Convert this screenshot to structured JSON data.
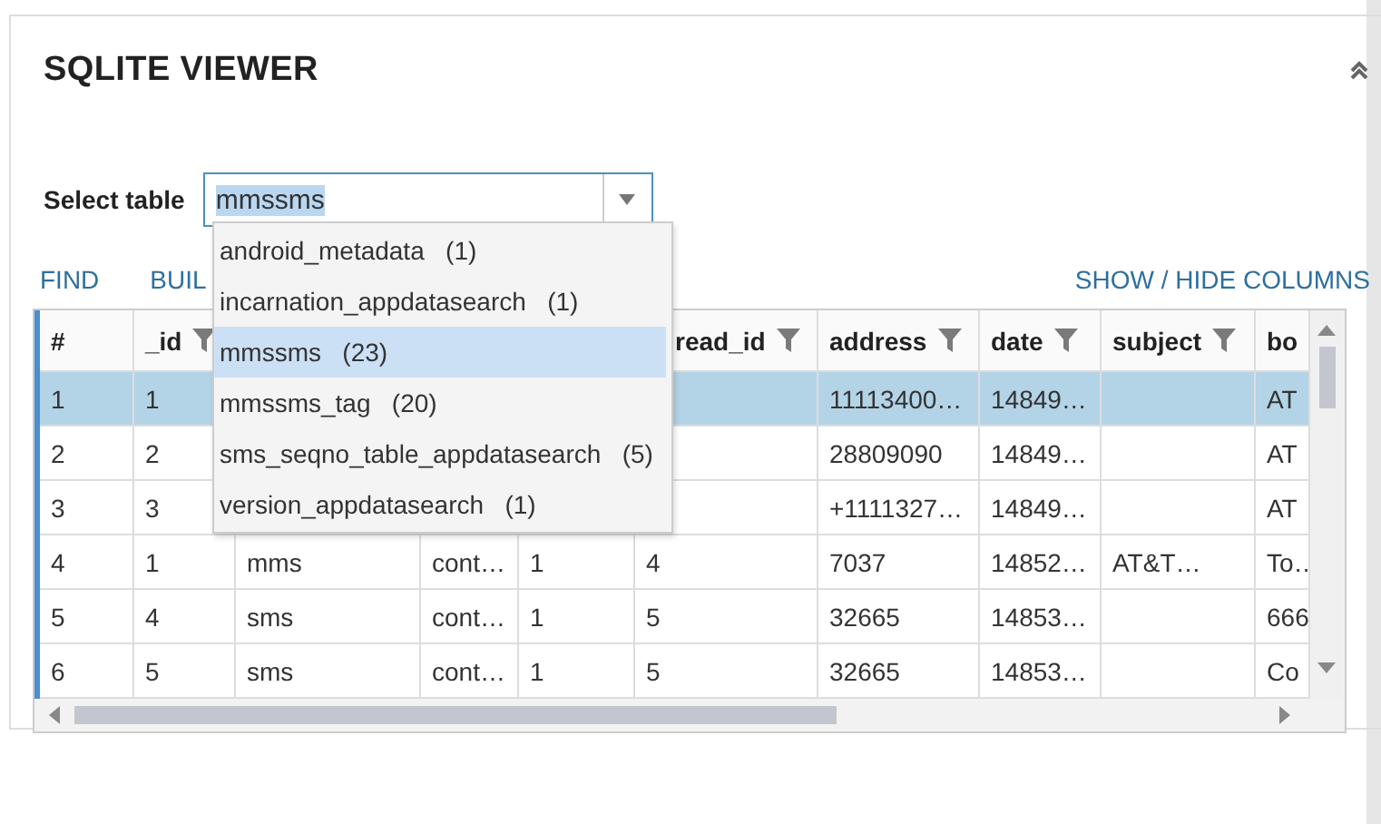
{
  "panel": {
    "title": "SQLITE VIEWER",
    "collapsed": false
  },
  "select_table": {
    "label": "Select table",
    "value": "mmssms",
    "text_selected": true,
    "expanded": true,
    "options": [
      {
        "name": "android_metadata",
        "count": "(1)",
        "selected": false
      },
      {
        "name": "incarnation_appdatasearch",
        "count": "(1)",
        "selected": false
      },
      {
        "name": "mmssms",
        "count": "(23)",
        "selected": true
      },
      {
        "name": "mmssms_tag",
        "count": "(20)",
        "selected": false
      },
      {
        "name": "sms_seqno_table_appdatasearch",
        "count": "(5)",
        "selected": false
      },
      {
        "name": "version_appdatasearch",
        "count": "(1)",
        "selected": false
      }
    ]
  },
  "toolbar": {
    "links": [
      "FIND",
      "BUIL"
    ],
    "show_hide": "SHOW / HIDE COLUMNS"
  },
  "table": {
    "columns": [
      {
        "label": "#",
        "filter": false
      },
      {
        "label": "_id",
        "filter": true
      },
      {},
      {},
      {},
      {
        "label": "read_id",
        "filter": true
      },
      {
        "label": "address",
        "filter": true
      },
      {
        "label": "date",
        "filter": true
      },
      {
        "label": "subject",
        "filter": true
      },
      {
        "label": "bo",
        "filter": false
      }
    ],
    "rows": [
      {
        "selected": true,
        "cells": [
          "1",
          "1",
          null,
          null,
          null,
          null,
          "11113400…",
          "14849…",
          null,
          "AT"
        ]
      },
      {
        "selected": false,
        "cells": [
          "2",
          "2",
          null,
          null,
          null,
          null,
          "28809090",
          "14849…",
          null,
          "AT"
        ]
      },
      {
        "selected": false,
        "cells": [
          "3",
          "3",
          null,
          null,
          null,
          null,
          "+1111327…",
          "14849…",
          null,
          "AT"
        ]
      },
      {
        "selected": false,
        "cells": [
          "4",
          "1",
          "mms",
          "cont…",
          "1",
          "4",
          "7037",
          "14852…",
          "AT&T…",
          "To…"
        ]
      },
      {
        "selected": false,
        "cells": [
          "5",
          "4",
          "sms",
          "cont…",
          "1",
          "5",
          "32665",
          "14853…",
          null,
          "666"
        ]
      },
      {
        "selected": false,
        "cells": [
          "6",
          "5",
          "sms",
          "cont…",
          "1",
          "5",
          "32665",
          "14853…",
          null,
          "Co"
        ]
      }
    ]
  }
}
